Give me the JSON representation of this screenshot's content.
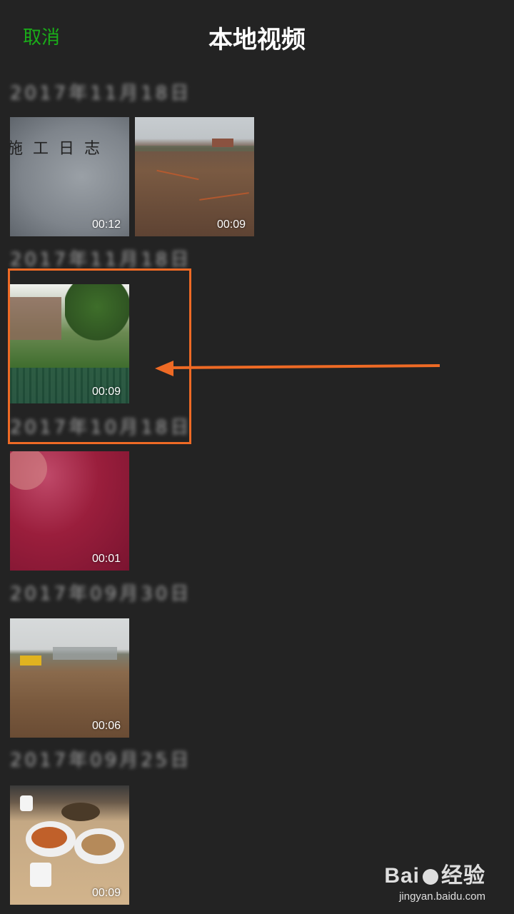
{
  "header": {
    "cancel_label": "取消",
    "title": "本地视频"
  },
  "sections": [
    {
      "date": "2017年11月18日",
      "videos": [
        {
          "duration": "00:12",
          "scene": "document"
        },
        {
          "duration": "00:09",
          "scene": "dirt-field"
        }
      ]
    },
    {
      "date": "2017年11月18日",
      "videos": [
        {
          "duration": "00:09",
          "scene": "park-ruins"
        }
      ]
    },
    {
      "date": "2017年10月18日",
      "videos": [
        {
          "duration": "00:01",
          "scene": "close-up"
        }
      ]
    },
    {
      "date": "2017年09月30日",
      "videos": [
        {
          "duration": "00:06",
          "scene": "construction-site"
        }
      ]
    },
    {
      "date": "2017年09月25日",
      "videos": [
        {
          "duration": "00:09",
          "scene": "dinner-table"
        }
      ]
    }
  ],
  "annotation": {
    "color": "#ee6a25"
  },
  "watermark": {
    "logo_text": "Bai",
    "logo_suffix": "经验",
    "url": "jingyan.baidu.com"
  },
  "colors": {
    "background": "#232323",
    "accent": "#1aad19"
  }
}
